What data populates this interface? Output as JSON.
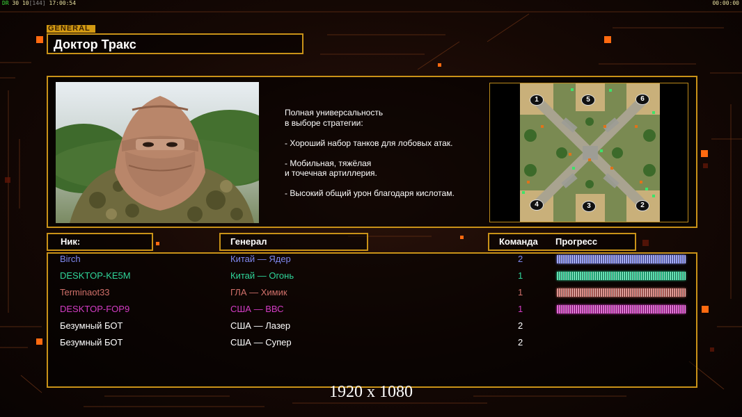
{
  "status_bar": {
    "fps_label": "DR",
    "fps": "30",
    "frame": "10",
    "frame_bracket": "[144]",
    "clock": "17:00:54",
    "timer": "00:00:00"
  },
  "general_header": {
    "tag": "GENERAL",
    "name": "Доктор Тракс"
  },
  "description": [
    "Полная универсальность",
    "в выборе стратегии:",
    "",
    "- Хороший набор танков для лобовых атак.",
    "",
    "- Мобильная, тяжёлая",
    "и точечная артиллерия.",
    "",
    "- Высокий общий урон благодаря кислотам."
  ],
  "map": {
    "start_positions": [
      "1",
      "5",
      "6",
      "4",
      "3",
      "2"
    ]
  },
  "columns": {
    "nick": "Ник:",
    "general": "Генерал",
    "team": "Команда",
    "progress": "Прогресс"
  },
  "players": [
    {
      "nick": "Birch",
      "general": "Китай — Ядер",
      "team": "2",
      "color": "#7f88f0",
      "progress_bar": true
    },
    {
      "nick": "DESKTOP-KE5M",
      "general": "Китай — Огонь",
      "team": "1",
      "color": "#2fd69a",
      "progress_bar": true
    },
    {
      "nick": "Terminaot33",
      "general": "ГЛА — Химик",
      "team": "1",
      "color": "#d0706a",
      "progress_bar": true
    },
    {
      "nick": "DESKTOP-FOP9",
      "general": "США — ВВС",
      "team": "1",
      "color": "#d43cc4",
      "progress_bar": true
    },
    {
      "nick": "Безумный БОТ",
      "general": "США — Лазер",
      "team": "2",
      "color": "#ffffff",
      "progress_bar": false
    },
    {
      "nick": "Безумный БОТ",
      "general": "США — Супер",
      "team": "2",
      "color": "#ffffff",
      "progress_bar": false
    }
  ],
  "resolution_label": "1920 x 1080",
  "colors": {
    "accent_gold": "#c99218",
    "orange_square": "#ff6a10"
  }
}
